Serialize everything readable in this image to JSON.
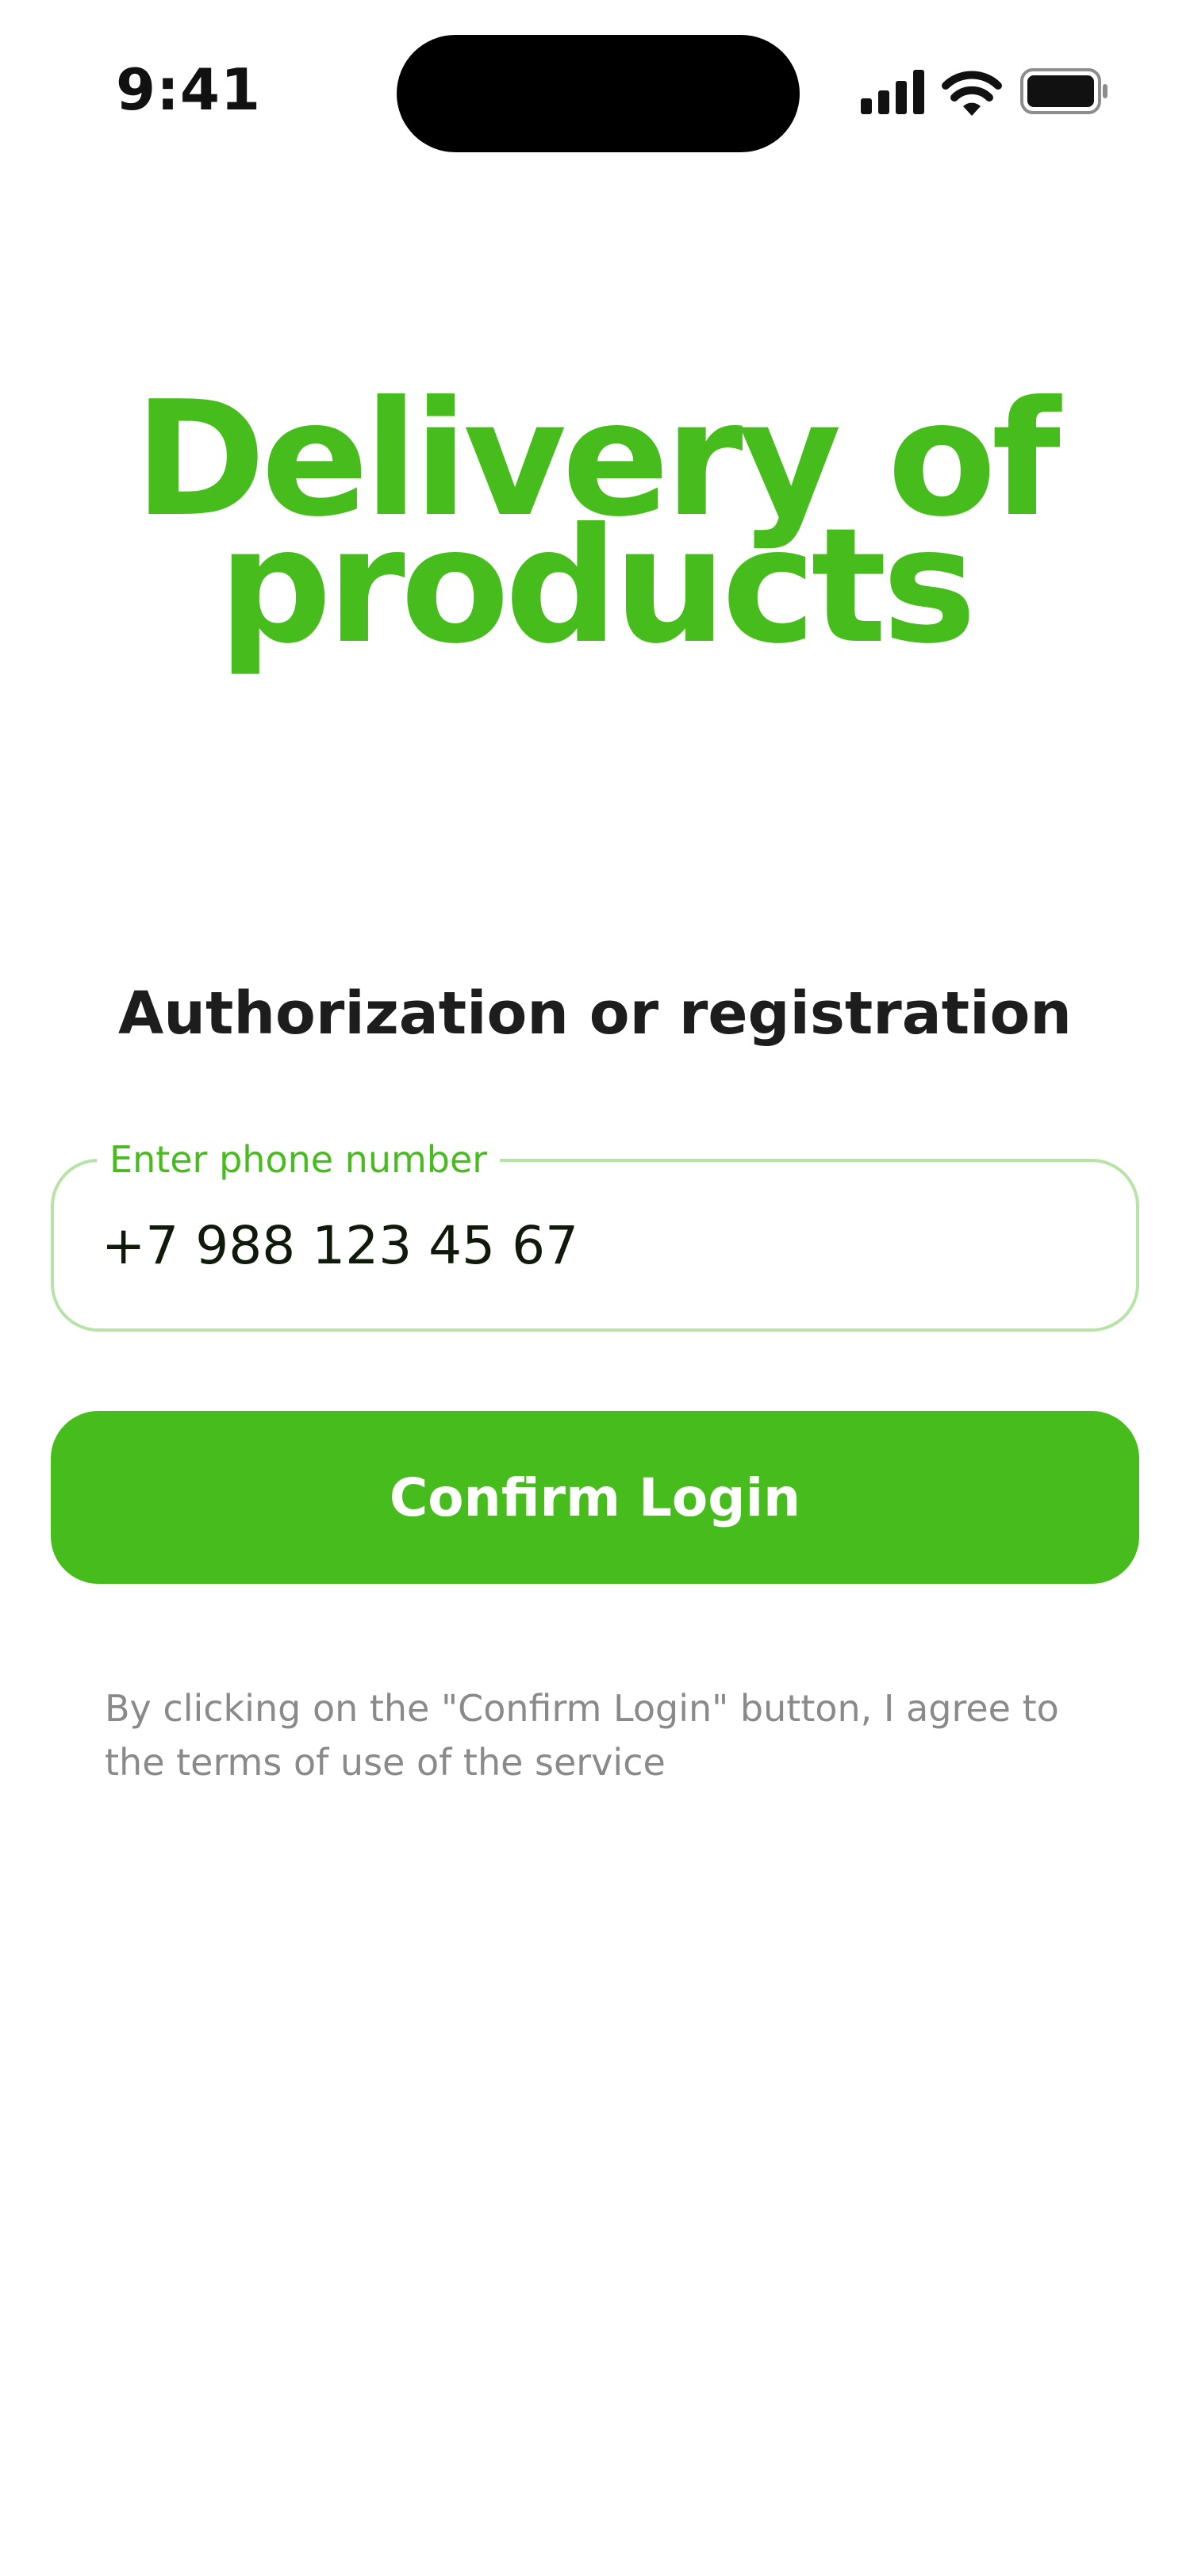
{
  "status_bar": {
    "time": "9:41",
    "icons": [
      "cellular-signal-icon",
      "wifi-icon",
      "battery-icon"
    ]
  },
  "hero": {
    "title_line1": "Delivery of",
    "title_line2": "products"
  },
  "auth": {
    "title": "Authorization or registration",
    "phone_label": "Enter phone number",
    "phone_value": "+7 988 123 45 67",
    "confirm_label": "Confirm Login",
    "terms": "By clicking on the \"Confirm Login\" button, I agree to the terms of use of the service"
  },
  "colors": {
    "accent": "#47bc1d",
    "field_border": "#b7e3a6",
    "muted_text": "#8a8a8a"
  }
}
